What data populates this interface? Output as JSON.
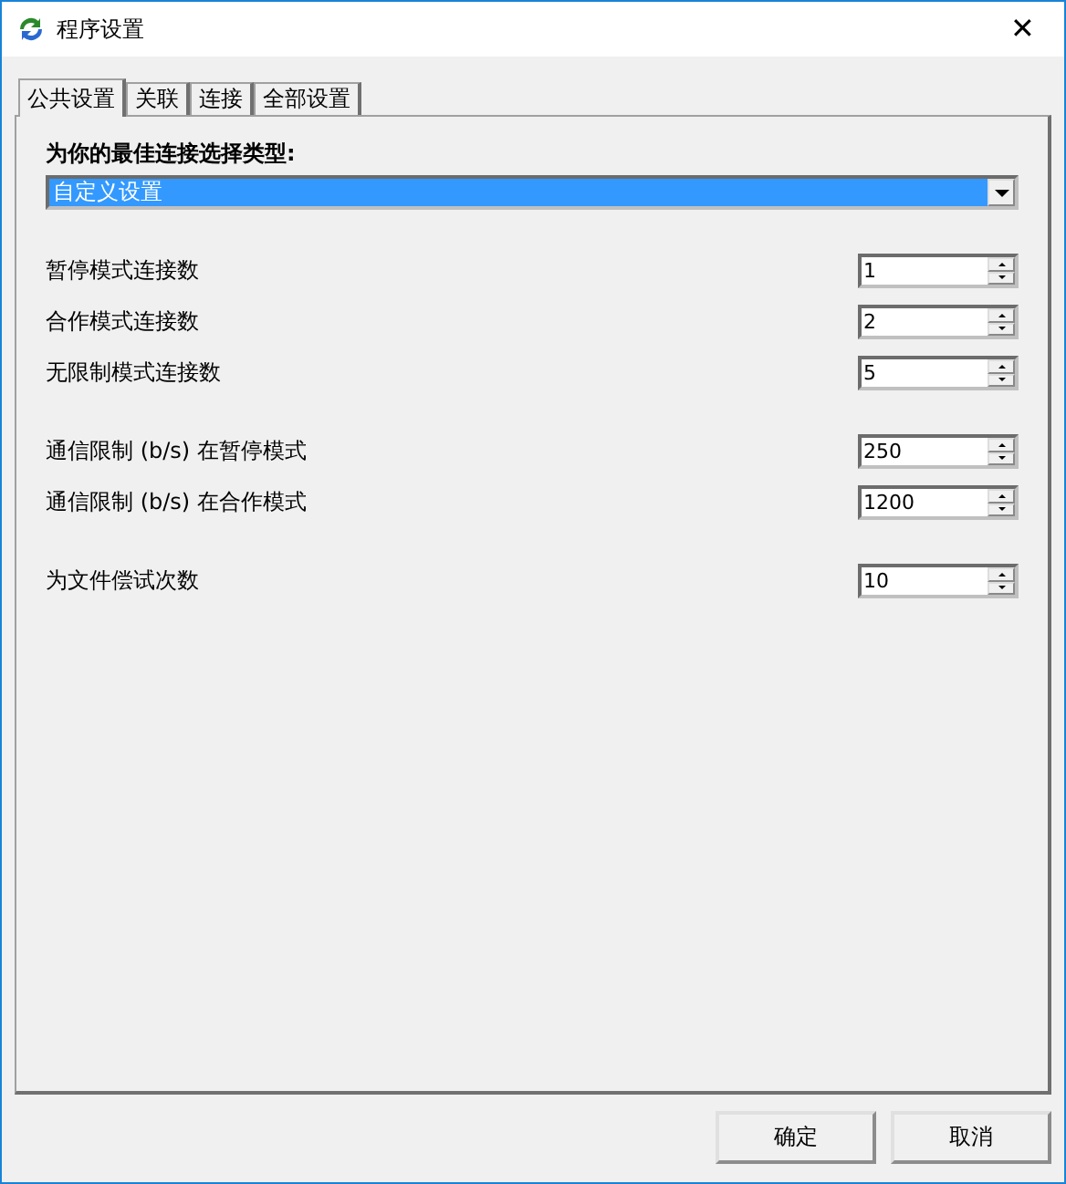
{
  "window": {
    "title": "程序设置",
    "close": "✕"
  },
  "tabs": [
    {
      "label": "公共设置",
      "selected": true
    },
    {
      "label": "关联",
      "selected": false
    },
    {
      "label": "连接",
      "selected": false
    },
    {
      "label": "全部设置",
      "selected": false
    }
  ],
  "connection_type": {
    "label": "为你的最佳连接选择类型:",
    "value": "自定义设置"
  },
  "setting_groups": [
    {
      "settings": [
        {
          "label": "暂停模式连接数",
          "value": "1"
        },
        {
          "label": "合作模式连接数",
          "value": "2"
        },
        {
          "label": "无限制模式连接数",
          "value": "5"
        }
      ]
    },
    {
      "settings": [
        {
          "label": "通信限制 (b/s) 在暂停模式",
          "value": "250"
        },
        {
          "label": "通信限制 (b/s) 在合作模式",
          "value": "1200"
        }
      ]
    },
    {
      "settings": [
        {
          "label": "为文件偿试次数",
          "value": "10"
        }
      ]
    }
  ],
  "buttons": [
    "确定",
    "取消"
  ]
}
